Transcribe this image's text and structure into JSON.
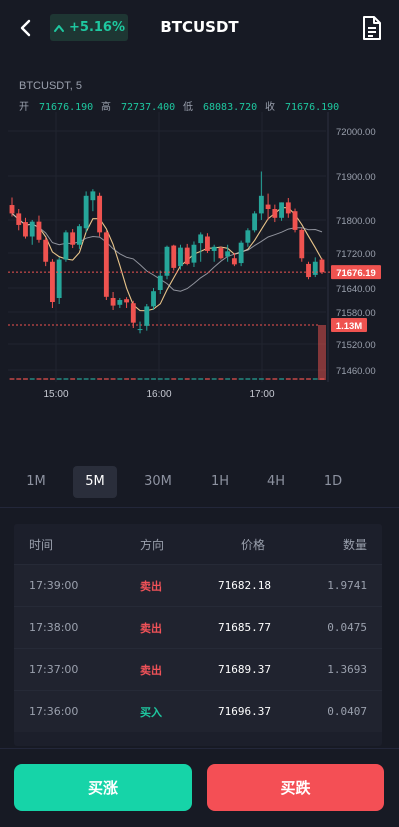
{
  "header": {
    "pair": "BTCUSDT",
    "change": "+5.16%",
    "change_color": "#1ec8a0"
  },
  "chart_info": {
    "symbol_interval": "BTCUSDT, 5",
    "open_label": "开",
    "open_value": "71676.190",
    "high_label": "高",
    "high_value": "72737.400",
    "low_label": "低",
    "low_value": "68083.720",
    "close_label": "收",
    "close_value": "71676.190"
  },
  "chart_data": {
    "type": "candlestick",
    "y_ticks": [
      "72000.00",
      "71900.00",
      "71800.00",
      "71720.00",
      "71640.00",
      "71580.00",
      "71520.00",
      "71460.00"
    ],
    "x_ticks": [
      "15:00",
      "16:00",
      "17:00"
    ],
    "last_price": "71676.19",
    "volume_label": "1.13M",
    "up_color": "#26a69a",
    "down_color": "#ef5350",
    "candles": [
      {
        "o": 71834,
        "h": 71851,
        "l": 71808,
        "c": 71815
      },
      {
        "o": 71815,
        "h": 71825,
        "l": 71775,
        "c": 71788
      },
      {
        "o": 71795,
        "h": 71805,
        "l": 71755,
        "c": 71760
      },
      {
        "o": 71760,
        "h": 71800,
        "l": 71740,
        "c": 71796
      },
      {
        "o": 71796,
        "h": 71810,
        "l": 71745,
        "c": 71752
      },
      {
        "o": 71752,
        "h": 71758,
        "l": 71690,
        "c": 71700
      },
      {
        "o": 71700,
        "h": 71706,
        "l": 71590,
        "c": 71605
      },
      {
        "o": 71615,
        "h": 71710,
        "l": 71600,
        "c": 71705
      },
      {
        "o": 71705,
        "h": 71775,
        "l": 71700,
        "c": 71770
      },
      {
        "o": 71770,
        "h": 71778,
        "l": 71732,
        "c": 71740
      },
      {
        "o": 71740,
        "h": 71790,
        "l": 71730,
        "c": 71785
      },
      {
        "o": 71780,
        "h": 71865,
        "l": 71770,
        "c": 71855
      },
      {
        "o": 71845,
        "h": 71870,
        "l": 71820,
        "c": 71865
      },
      {
        "o": 71855,
        "h": 71862,
        "l": 71760,
        "c": 71770
      },
      {
        "o": 71770,
        "h": 71775,
        "l": 71610,
        "c": 71618
      },
      {
        "o": 71615,
        "h": 71630,
        "l": 71585,
        "c": 71596
      },
      {
        "o": 71598,
        "h": 71615,
        "l": 71590,
        "c": 71610
      },
      {
        "o": 71612,
        "h": 71617,
        "l": 71590,
        "c": 71604
      },
      {
        "o": 71602,
        "h": 71608,
        "l": 71550,
        "c": 71560
      },
      {
        "o": 71548,
        "h": 71562,
        "l": 71540,
        "c": 71548
      },
      {
        "o": 71554,
        "h": 71600,
        "l": 71545,
        "c": 71594
      },
      {
        "o": 71594,
        "h": 71640,
        "l": 71585,
        "c": 71632
      },
      {
        "o": 71635,
        "h": 71680,
        "l": 71625,
        "c": 71668
      },
      {
        "o": 71668,
        "h": 71738,
        "l": 71660,
        "c": 71735
      },
      {
        "o": 71738,
        "h": 71740,
        "l": 71680,
        "c": 71686
      },
      {
        "o": 71690,
        "h": 71740,
        "l": 71682,
        "c": 71733
      },
      {
        "o": 71733,
        "h": 71742,
        "l": 71692,
        "c": 71695
      },
      {
        "o": 71698,
        "h": 71748,
        "l": 71688,
        "c": 71740
      },
      {
        "o": 71744,
        "h": 71770,
        "l": 71700,
        "c": 71765
      },
      {
        "o": 71760,
        "h": 71768,
        "l": 71720,
        "c": 71725
      },
      {
        "o": 71725,
        "h": 71740,
        "l": 71700,
        "c": 71735
      },
      {
        "o": 71732,
        "h": 71736,
        "l": 71705,
        "c": 71708
      },
      {
        "o": 71712,
        "h": 71740,
        "l": 71700,
        "c": 71724
      },
      {
        "o": 71708,
        "h": 71720,
        "l": 71690,
        "c": 71694
      },
      {
        "o": 71697,
        "h": 71750,
        "l": 71690,
        "c": 71745
      },
      {
        "o": 71745,
        "h": 71780,
        "l": 71735,
        "c": 71775
      },
      {
        "o": 71775,
        "h": 71820,
        "l": 71770,
        "c": 71815
      },
      {
        "o": 71815,
        "h": 71910,
        "l": 71800,
        "c": 71855
      },
      {
        "o": 71835,
        "h": 71860,
        "l": 71800,
        "c": 71825
      },
      {
        "o": 71825,
        "h": 71835,
        "l": 71795,
        "c": 71805
      },
      {
        "o": 71805,
        "h": 71840,
        "l": 71798,
        "c": 71840
      },
      {
        "o": 71840,
        "h": 71850,
        "l": 71805,
        "c": 71815
      },
      {
        "o": 71820,
        "h": 71826,
        "l": 71770,
        "c": 71776
      },
      {
        "o": 71776,
        "h": 71780,
        "l": 71700,
        "c": 71708
      },
      {
        "o": 71695,
        "h": 71700,
        "l": 71660,
        "c": 71665
      },
      {
        "o": 71670,
        "h": 71710,
        "l": 71665,
        "c": 71700
      },
      {
        "o": 71705,
        "h": 71708,
        "l": 71672,
        "c": 71676
      }
    ]
  },
  "timeframes": [
    "1M",
    "5M",
    "30M",
    "1H",
    "4H",
    "1D"
  ],
  "active_timeframe": "5M",
  "trades": {
    "headers": [
      "时间",
      "方向",
      "价格",
      "数量"
    ],
    "rows": [
      {
        "time": "17:39:00",
        "side": "卖出",
        "side_type": "sell",
        "price": "71682.18",
        "volume": "1.9741"
      },
      {
        "time": "17:38:00",
        "side": "卖出",
        "side_type": "sell",
        "price": "71685.77",
        "volume": "0.0475"
      },
      {
        "time": "17:37:00",
        "side": "卖出",
        "side_type": "sell",
        "price": "71689.37",
        "volume": "1.3693"
      },
      {
        "time": "17:36:00",
        "side": "买入",
        "side_type": "buy",
        "price": "71696.37",
        "volume": "0.0407"
      }
    ]
  },
  "actions": {
    "buy_label": "买涨",
    "sell_label": "买跌",
    "buy_color": "#16d4a8",
    "sell_color": "#f44f55"
  }
}
